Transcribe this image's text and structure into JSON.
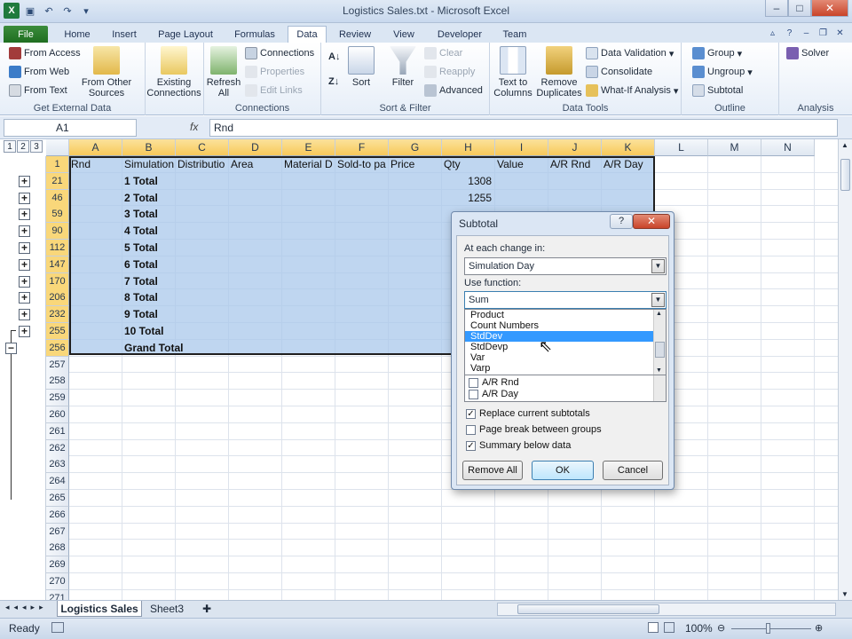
{
  "window": {
    "title": "Logistics Sales.txt - Microsoft Excel"
  },
  "tabs": [
    "File",
    "Home",
    "Insert",
    "Page Layout",
    "Formulas",
    "Data",
    "Review",
    "View",
    "Developer",
    "Team"
  ],
  "ribbon": {
    "get_external": {
      "label": "Get External Data",
      "access": "From Access",
      "web": "From Web",
      "text": "From Text",
      "other": "From Other Sources",
      "existing": "Existing Connections"
    },
    "connections": {
      "label": "Connections",
      "refresh": "Refresh All",
      "connections": "Connections",
      "properties": "Properties",
      "edit_links": "Edit Links"
    },
    "sort_filter": {
      "label": "Sort & Filter",
      "sort": "Sort",
      "filter": "Filter",
      "clear": "Clear",
      "reapply": "Reapply",
      "advanced": "Advanced"
    },
    "data_tools": {
      "label": "Data Tools",
      "text_to_columns": "Text to Columns",
      "remove_duplicates": "Remove Duplicates",
      "data_validation": "Data Validation",
      "consolidate": "Consolidate",
      "what_if": "What-If Analysis"
    },
    "outline": {
      "label": "Outline",
      "group": "Group",
      "ungroup": "Ungroup",
      "subtotal": "Subtotal"
    },
    "analysis": {
      "label": "Analysis",
      "solver": "Solver"
    }
  },
  "formula_bar": {
    "name_box": "A1",
    "fx": "fx",
    "content": "Rnd"
  },
  "outline_levels": [
    "1",
    "2",
    "3"
  ],
  "columns": [
    "A",
    "B",
    "C",
    "D",
    "E",
    "F",
    "G",
    "H",
    "I",
    "J",
    "K",
    "L",
    "M",
    "N"
  ],
  "header_row": [
    "Rnd",
    "Simulation",
    "Distributio",
    "Area",
    "Material D",
    "Sold-to pa",
    "Price",
    "Qty",
    "Value",
    "A/R Rnd",
    "A/R Day"
  ],
  "rows": [
    {
      "num": "1"
    },
    {
      "num": "21",
      "label": "1 Total",
      "qty": "1308"
    },
    {
      "num": "46",
      "label": "2 Total",
      "qty": "1255"
    },
    {
      "num": "59",
      "label": "3 Total"
    },
    {
      "num": "90",
      "label": "4 Total"
    },
    {
      "num": "112",
      "label": "5 Total"
    },
    {
      "num": "147",
      "label": "6 Total"
    },
    {
      "num": "170",
      "label": "7 Total"
    },
    {
      "num": "206",
      "label": "8 Total"
    },
    {
      "num": "232",
      "label": "9 Total"
    },
    {
      "num": "255",
      "label": "10 Total"
    },
    {
      "num": "256",
      "label": "Grand Total"
    },
    {
      "num": "257"
    },
    {
      "num": "258"
    },
    {
      "num": "259"
    },
    {
      "num": "260"
    },
    {
      "num": "261"
    },
    {
      "num": "262"
    },
    {
      "num": "263"
    },
    {
      "num": "264"
    },
    {
      "num": "265"
    },
    {
      "num": "266"
    },
    {
      "num": "267"
    },
    {
      "num": "268"
    },
    {
      "num": "269"
    },
    {
      "num": "270"
    },
    {
      "num": "271"
    }
  ],
  "sheets": [
    "Logistics Sales",
    "Sheet3"
  ],
  "status": {
    "ready": "Ready",
    "zoom": "100%"
  },
  "dialog": {
    "title": "Subtotal",
    "help": "?",
    "change_label": "At each change in:",
    "change_value": "Simulation Day",
    "function_label": "Use function:",
    "function_value": "Sum",
    "function_options": [
      "Product",
      "Count Numbers",
      "StdDev",
      "StdDevp",
      "Var",
      "Varp"
    ],
    "highlighted_option": "StdDev",
    "add_to": [
      "A/R Rnd",
      "A/R Day"
    ],
    "replace": "Replace current subtotals",
    "page_break": "Page break between groups",
    "summary": "Summary below data",
    "remove_all": "Remove All",
    "ok": "OK",
    "cancel": "Cancel"
  }
}
